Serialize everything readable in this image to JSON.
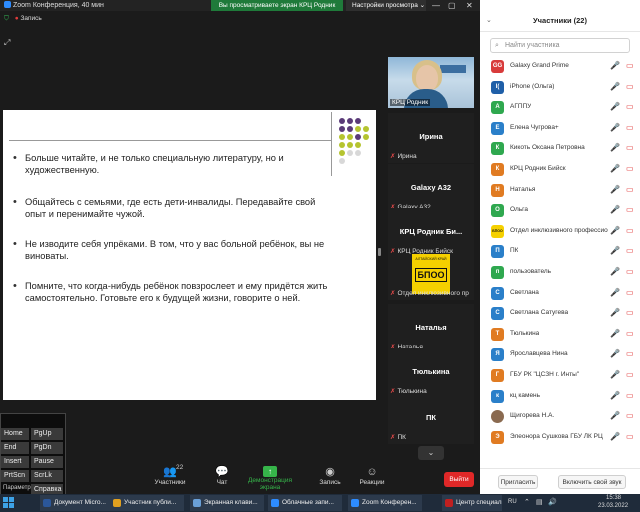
{
  "titlebar": {
    "title": "Zoom Конференция, 40 мин",
    "share_banner": "Вы просматриваете экран КРЦ Родник",
    "view_options": "Настройки просмотра",
    "record": "Запись"
  },
  "slide": {
    "bullets": [
      "Больше читайте, и не только специальную литературу, но и художественную.",
      "Общайтесь с семьями, где есть дети-инвалиды. Передавайте свой опыт и перенимайте чужой.",
      "Не изводите себя упрёками. В том, что у вас больной ребёнок, вы не виноваты.",
      "Помните, что когда-нибудь ребёнок повзрослеет и ему придётся жить самостоятельно. Готовьте его к будущей жизни, говорите о ней."
    ]
  },
  "tiles": {
    "video_label": "КРЦ Родник",
    "items": [
      {
        "name": "Ирина",
        "label": "Ирина"
      },
      {
        "name": "Galaxy A32",
        "label": "Galaxy A32"
      },
      {
        "name": "КРЦ Родник Би...",
        "label": "КРЦ Родник Бийск"
      },
      {
        "name": "",
        "label": "Отдел инклюзивного пр"
      },
      {
        "name": "Наталья",
        "label": "Наталья"
      },
      {
        "name": "Тюлькина",
        "label": "Тюлькина"
      },
      {
        "name": "ПК",
        "label": "ПК"
      }
    ],
    "logo_text": "БПОО",
    "logo_small": "АЛТАЙСКИЙ КРАЙ"
  },
  "toolbar": {
    "participants_label": "Участники",
    "participants_count": "22",
    "chat_label": "Чат",
    "share_label": "Демонстрация экрана",
    "record_label": "Запись",
    "reactions_label": "Реакции",
    "leave_label": "Выйти"
  },
  "osk": {
    "keys": [
      "Home",
      "PgUp",
      "End",
      "PgDn",
      "Insert",
      "Pause",
      "PrtScn",
      "ScrLk"
    ],
    "params": "Параметры",
    "help": "Справка"
  },
  "panel": {
    "title": "Участники (22)",
    "search_placeholder": "Найти участника",
    "participants": [
      {
        "initials": "GG",
        "color": "#d83b3b",
        "name": "Galaxy Grand Prime"
      },
      {
        "initials": "I(",
        "color": "#1f5fa8",
        "name": "iPhone (Ольга)"
      },
      {
        "initials": "А",
        "color": "#2fa84f",
        "name": "АГППУ"
      },
      {
        "initials": "Е",
        "color": "#2a7fc9",
        "name": "Елена Чугрова+"
      },
      {
        "initials": "К",
        "color": "#2fa84f",
        "name": "Кикоть Оксана Петровна"
      },
      {
        "initials": "К",
        "color": "#e07b22",
        "name": "КРЦ Родник Бийск"
      },
      {
        "initials": "Н",
        "color": "#e07b22",
        "name": "Наталья"
      },
      {
        "initials": "О",
        "color": "#2fa84f",
        "name": "Ольга"
      },
      {
        "initials": "БПОО",
        "color": "#f5d000",
        "name": "Отдел инклюзивного профессионального образования"
      },
      {
        "initials": "П",
        "color": "#2a7fc9",
        "name": "ПК"
      },
      {
        "initials": "п",
        "color": "#2fa84f",
        "name": "пользователь"
      },
      {
        "initials": "С",
        "color": "#2a7fc9",
        "name": "Светлана"
      },
      {
        "initials": "С",
        "color": "#2a7fc9",
        "name": "Светлана Сатугева"
      },
      {
        "initials": "Т",
        "color": "#e07b22",
        "name": "Тюлькина"
      },
      {
        "initials": "Я",
        "color": "#2a7fc9",
        "name": "Ярославцева Нина"
      },
      {
        "initials": "Г",
        "color": "#e07b22",
        "name": "ГБУ РК \"ЦСЗН г. Инты\""
      },
      {
        "initials": "к",
        "color": "#2a7fc9",
        "name": "кц камень"
      },
      {
        "initials": "",
        "color": "#8a6a50",
        "name": "Щигорева Н.А."
      },
      {
        "initials": "Э",
        "color": "#e07b22",
        "name": "Элеонора Сушкова ГБУ ЛК РЦ"
      }
    ],
    "invite_label": "Пригласить",
    "unmute_label": "Включить свой звук"
  },
  "taskbar": {
    "items": [
      {
        "label": "Документ Micro...",
        "color": "#2b579a"
      },
      {
        "label": "Участник публи...",
        "color": "#e0a020"
      },
      {
        "label": "Экранная клави...",
        "color": "#6aa0d8"
      },
      {
        "label": "Облачные запи...",
        "color": "#2d8cff"
      },
      {
        "label": "Zoom Конферен...",
        "color": "#2d8cff"
      },
      {
        "label": "Центр специаль...",
        "color": "#c02020"
      }
    ],
    "lang": "RU",
    "time": "15:38",
    "date": "23.03.2022"
  }
}
